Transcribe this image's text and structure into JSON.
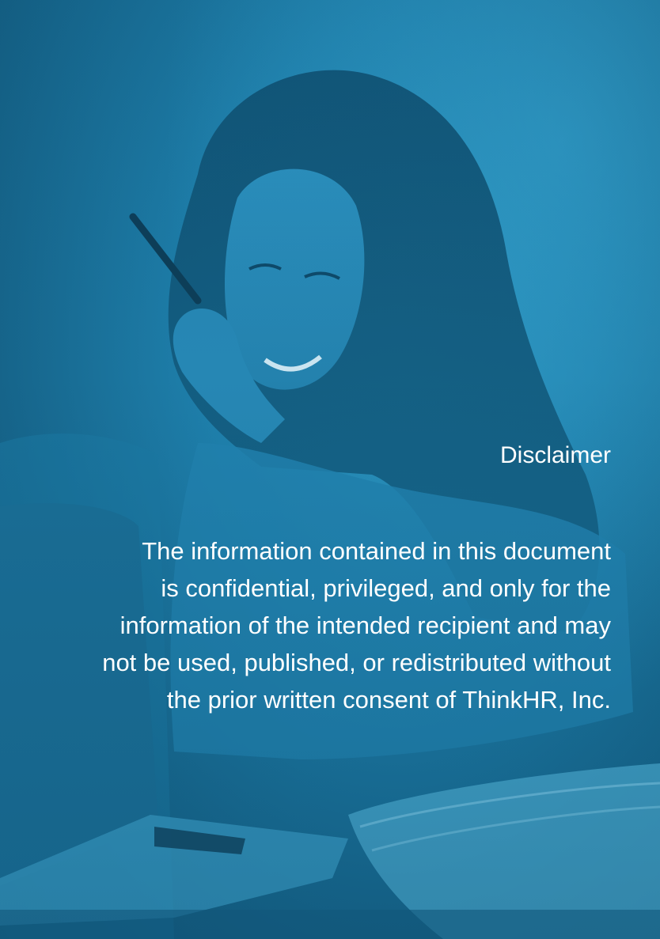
{
  "disclaimer": {
    "title": "Disclaimer",
    "lines": [
      "The information contained in this document",
      "is confidential, privileged, and only for the",
      "information of the intended recipient and may",
      "not be used, published, or redistributed without",
      "the prior written consent of ThinkHR, Inc."
    ]
  },
  "colors": {
    "overlay_tint": "#1e7fab",
    "text": "#ffffff"
  }
}
